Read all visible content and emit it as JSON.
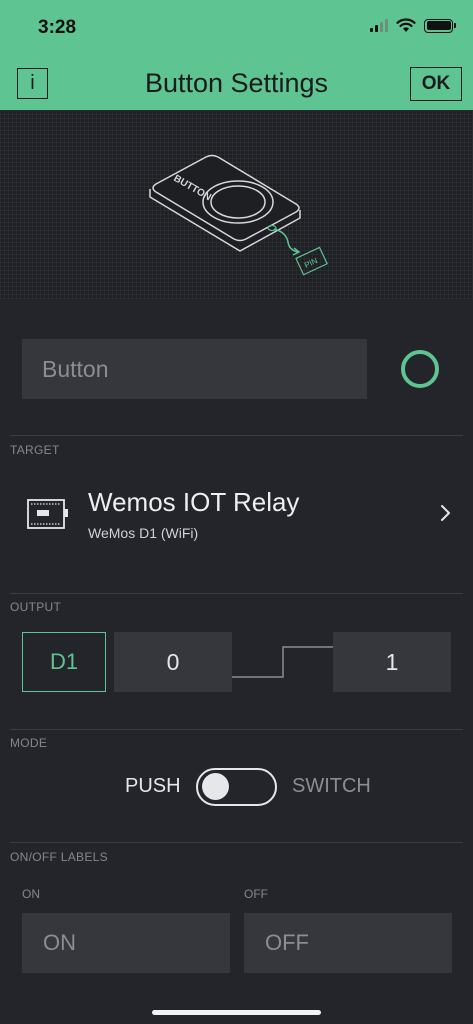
{
  "status": {
    "time": "3:28"
  },
  "nav": {
    "info_label": "i",
    "title": "Button Settings",
    "ok_label": "OK"
  },
  "hero": {
    "device_label": "BUTTON",
    "pin_label": "PIN"
  },
  "widget": {
    "name_placeholder": "Button",
    "accent_color": "#5ec491"
  },
  "target": {
    "section": "TARGET",
    "device_name": "Wemos IOT Relay",
    "board": "WeMos D1 (WiFi)"
  },
  "output": {
    "section": "OUTPUT",
    "pin": "D1",
    "low": "0",
    "high": "1"
  },
  "mode": {
    "section": "MODE",
    "push": "PUSH",
    "switch": "SWITCH",
    "selected": "PUSH"
  },
  "labels": {
    "section": "ON/OFF LABELS",
    "on_title": "ON",
    "off_title": "OFF",
    "on_placeholder": "ON",
    "off_placeholder": "OFF"
  }
}
